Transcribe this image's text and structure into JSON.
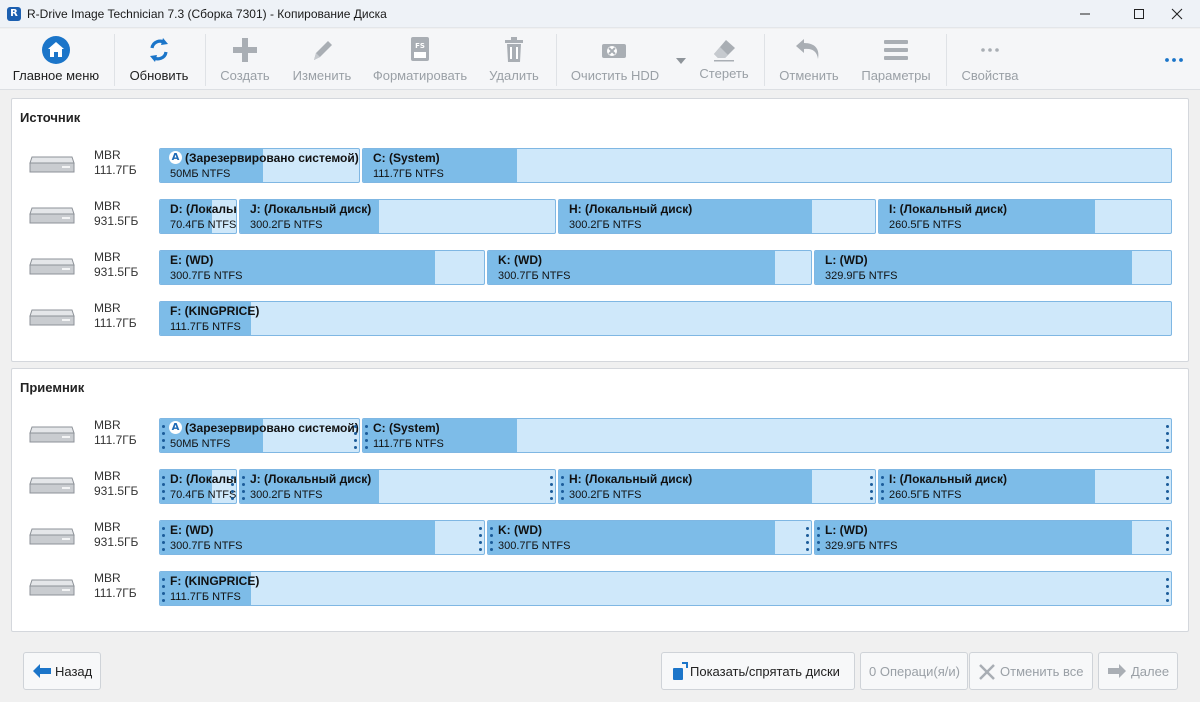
{
  "window": {
    "title": "R-Drive Image Technician 7.3 (Сборка 7301) - Копирование Диска",
    "app_icon_letter": "R"
  },
  "toolbar": {
    "main_menu": "Главное меню",
    "refresh": "Обновить",
    "create": "Создать",
    "edit": "Изменить",
    "format": "Форматировать",
    "delete": "Удалить",
    "wipe_hdd": "Очистить HDD",
    "erase": "Стереть",
    "undo": "Отменить",
    "parameters": "Параметры",
    "properties": "Свойства",
    "format_icon_text": "FS"
  },
  "source": {
    "title": "Источник",
    "disks": [
      {
        "type": "MBR",
        "size": "111.7ГБ",
        "partitions": [
          {
            "name": "(Зарезервировано системой)",
            "info": "50МБ NTFS",
            "fill": 0.52,
            "icon_letter": "A"
          },
          {
            "name": "C: (System)",
            "info": "111.7ГБ NTFS",
            "fill": 0.19
          }
        ]
      },
      {
        "type": "MBR",
        "size": "931.5ГБ",
        "partitions": [
          {
            "name": "D: (Локальный диск)",
            "info": "70.4ГБ NTFS",
            "fill": 0.68
          },
          {
            "name": "J: (Локальный диск)",
            "info": "300.2ГБ NTFS",
            "fill": 0.44
          },
          {
            "name": "H: (Локальный диск)",
            "info": "300.2ГБ NTFS",
            "fill": 0.8
          },
          {
            "name": "I: (Локальный диск)",
            "info": "260.5ГБ NTFS",
            "fill": 0.74
          }
        ]
      },
      {
        "type": "MBR",
        "size": "931.5ГБ",
        "partitions": [
          {
            "name": "E: (WD)",
            "info": "300.7ГБ NTFS",
            "fill": 0.85
          },
          {
            "name": "K: (WD)",
            "info": "300.7ГБ NTFS",
            "fill": 0.89
          },
          {
            "name": "L: (WD)",
            "info": "329.9ГБ NTFS",
            "fill": 0.89
          }
        ]
      },
      {
        "type": "MBR",
        "size": "111.7ГБ",
        "partitions": [
          {
            "name": "F: (KINGPRICE)",
            "info": "111.7ГБ NTFS",
            "fill": 0.09
          }
        ]
      }
    ]
  },
  "target": {
    "title": "Приемник",
    "disks": [
      {
        "type": "MBR",
        "size": "111.7ГБ",
        "partitions": [
          {
            "name": "(Зарезервировано системой)",
            "info": "50МБ NTFS",
            "fill": 0.52,
            "icon_letter": "A"
          },
          {
            "name": "C: (System)",
            "info": "111.7ГБ NTFS",
            "fill": 0.19
          }
        ]
      },
      {
        "type": "MBR",
        "size": "931.5ГБ",
        "partitions": [
          {
            "name": "D: (Локальный диск)",
            "info": "70.4ГБ NTFS",
            "fill": 0.68
          },
          {
            "name": "J: (Локальный диск)",
            "info": "300.2ГБ NTFS",
            "fill": 0.44
          },
          {
            "name": "H: (Локальный диск)",
            "info": "300.2ГБ NTFS",
            "fill": 0.8
          },
          {
            "name": "I: (Локальный диск)",
            "info": "260.5ГБ NTFS",
            "fill": 0.74
          }
        ]
      },
      {
        "type": "MBR",
        "size": "931.5ГБ",
        "partitions": [
          {
            "name": "E: (WD)",
            "info": "300.7ГБ NTFS",
            "fill": 0.85
          },
          {
            "name": "K: (WD)",
            "info": "300.7ГБ NTFS",
            "fill": 0.89
          },
          {
            "name": "L: (WD)",
            "info": "329.9ГБ NTFS",
            "fill": 0.89
          }
        ]
      },
      {
        "type": "MBR",
        "size": "111.7ГБ",
        "partitions": [
          {
            "name": "F: (KINGPRICE)",
            "info": "111.7ГБ NTFS",
            "fill": 0.09
          }
        ]
      }
    ]
  },
  "bottom": {
    "back": "Назад",
    "show_hide_disks": "Показать/спрятать диски",
    "operations": "0 Операци(я/и)",
    "cancel_all": "Отменить все",
    "next": "Далее"
  },
  "colors": {
    "accent": "#1b75c9",
    "partition_used": "#7dbce8",
    "partition_free": "#cfe8fa",
    "partition_border": "#7fb7e3"
  }
}
